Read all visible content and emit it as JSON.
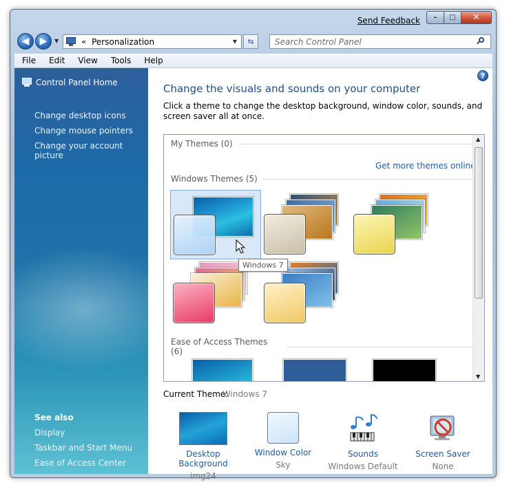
{
  "window": {
    "send_feedback": "Send Feedback",
    "caption": {
      "minimize": "–",
      "maximize": "□",
      "close": "✕"
    }
  },
  "navigation": {
    "back": "◀",
    "forward": "▶",
    "address_chevron": "«",
    "address": "Personalization",
    "search_placeholder": "Search Control Panel"
  },
  "menu": [
    "File",
    "Edit",
    "View",
    "Tools",
    "Help"
  ],
  "sidebar": {
    "home": "Control Panel Home",
    "links": [
      "Change desktop icons",
      "Change mouse pointers",
      "Change your account picture"
    ],
    "see_also_title": "See also",
    "see_also": [
      "Display",
      "Taskbar and Start Menu",
      "Ease of Access Center"
    ]
  },
  "main": {
    "help": "?",
    "title": "Change the visuals and sounds on your computer",
    "description": "Click a theme to change the desktop background, window color, sounds, and screen saver all at once.",
    "my_themes": "My Themes (0)",
    "get_more": "Get more themes online",
    "windows_themes": "Windows Themes (5)",
    "ease_themes": "Ease of Access Themes (6)",
    "tooltip": "Windows 7",
    "current_theme_label": "Current Theme:",
    "current_theme_value": "Windows 7"
  },
  "bottom": [
    {
      "label": "Desktop Background",
      "sub": "img24"
    },
    {
      "label": "Window Color",
      "sub": "Sky"
    },
    {
      "label": "Sounds",
      "sub": "Windows Default"
    },
    {
      "label": "Screen Saver",
      "sub": "None"
    }
  ],
  "colors": {
    "link": "#1e5ca8",
    "title": "#1e4e8c",
    "sidebar_top": "#2d5f9c",
    "sidebar_bottom": "#5dc1d4",
    "sky_swatch": "#cde4fb",
    "close_button": "#cf5a3f"
  },
  "icons": {
    "back": "back-arrow-icon",
    "forward": "forward-arrow-icon",
    "refresh": "refresh-icon",
    "search": "search-icon",
    "help": "help-icon",
    "control_panel": "control-panel-icon",
    "sounds": "music-notes-icon",
    "screen_saver": "screen-saver-disabled-icon"
  }
}
